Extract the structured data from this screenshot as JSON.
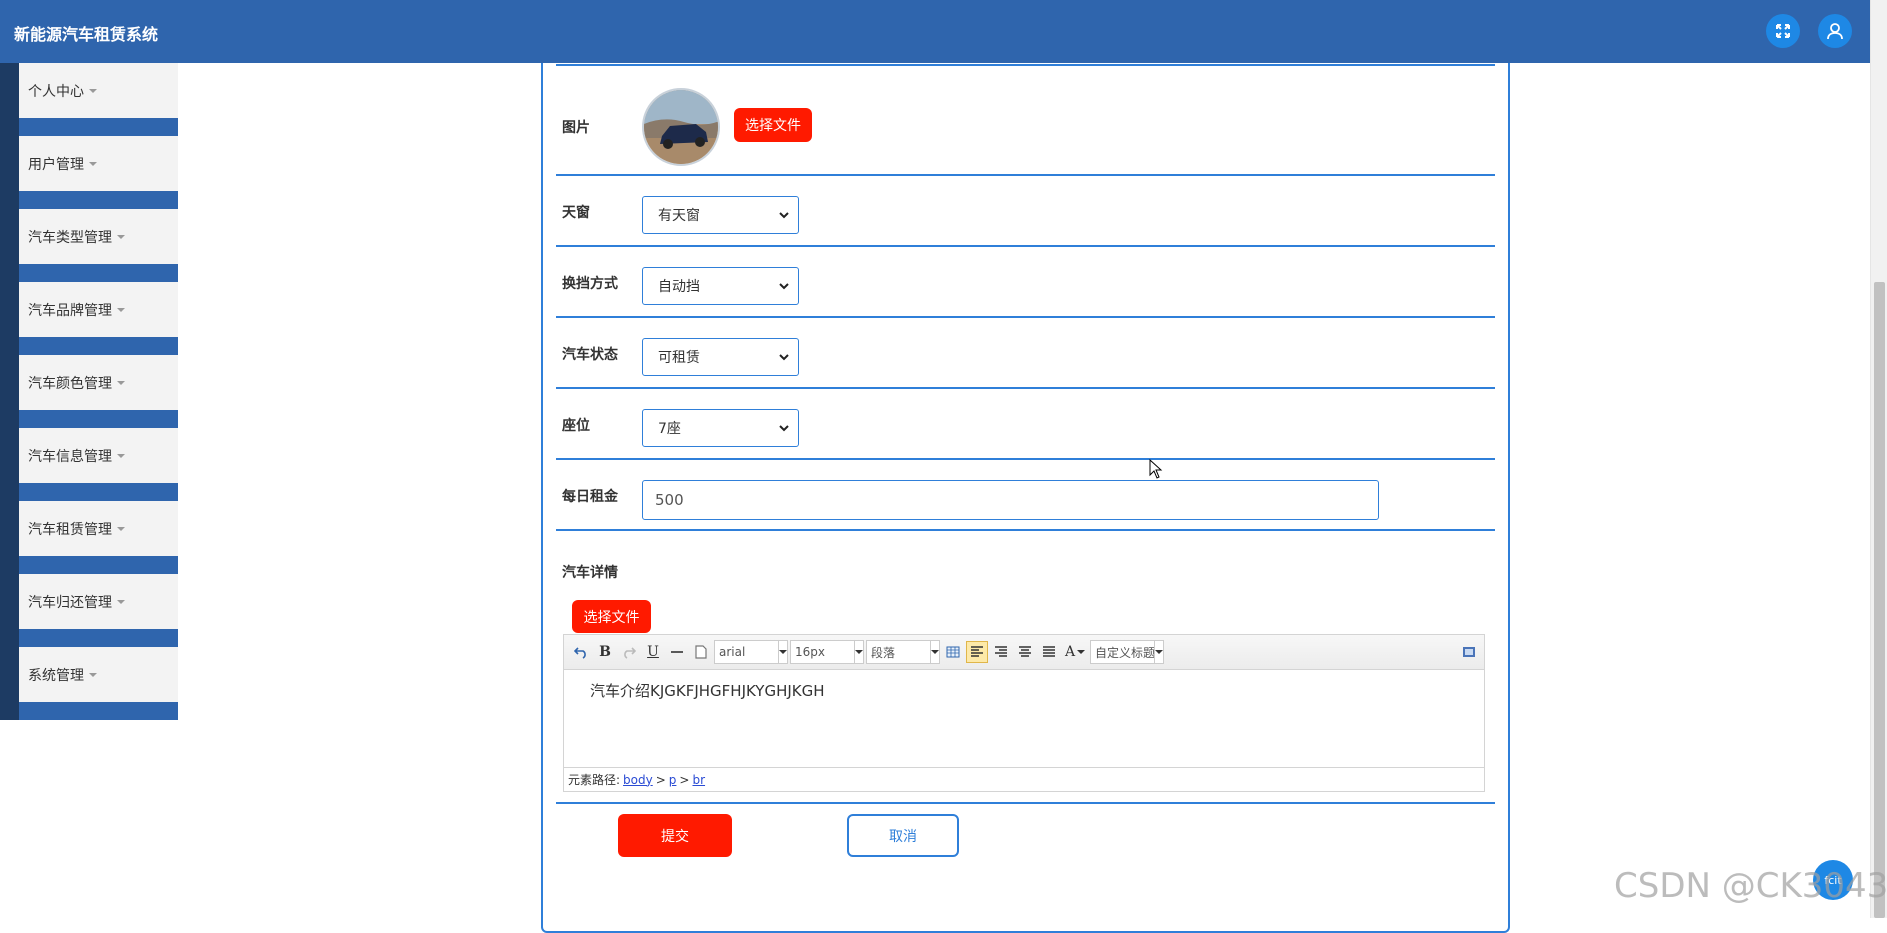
{
  "app": {
    "title": "新能源汽车租赁系统"
  },
  "header": {
    "fullscreen_icon": "expand-icon",
    "user_icon": "user-icon"
  },
  "sidebar": {
    "items": [
      {
        "label": "个人中心"
      },
      {
        "label": "用户管理"
      },
      {
        "label": "汽车类型管理"
      },
      {
        "label": "汽车品牌管理"
      },
      {
        "label": "汽车颜色管理"
      },
      {
        "label": "汽车信息管理"
      },
      {
        "label": "汽车租赁管理"
      },
      {
        "label": "汽车归还管理"
      },
      {
        "label": "系统管理"
      }
    ]
  },
  "form": {
    "picture": {
      "label": "图片",
      "choose_file": "选择文件"
    },
    "sunroof": {
      "label": "天窗",
      "value": "有天窗"
    },
    "transmission": {
      "label": "换挡方式",
      "value": "自动挡"
    },
    "status": {
      "label": "汽车状态",
      "value": "可租赁"
    },
    "seats": {
      "label": "座位",
      "value": "7座"
    },
    "daily_rent": {
      "label": "每日租金",
      "value": "500"
    },
    "details": {
      "label": "汽车详情",
      "choose_file": "选择文件",
      "font_family": "arial",
      "font_size": "16px",
      "paragraph": "段落",
      "custom_heading": "自定义标题",
      "content": "汽车介绍KJGKFJHGFHJKYGHJKGH",
      "path_label": "元素路径:",
      "path": [
        "body",
        "p",
        "br"
      ]
    },
    "submit": "提交",
    "cancel": "取消"
  },
  "watermark": "CSDN @CK3043",
  "float_button": "fcit"
}
